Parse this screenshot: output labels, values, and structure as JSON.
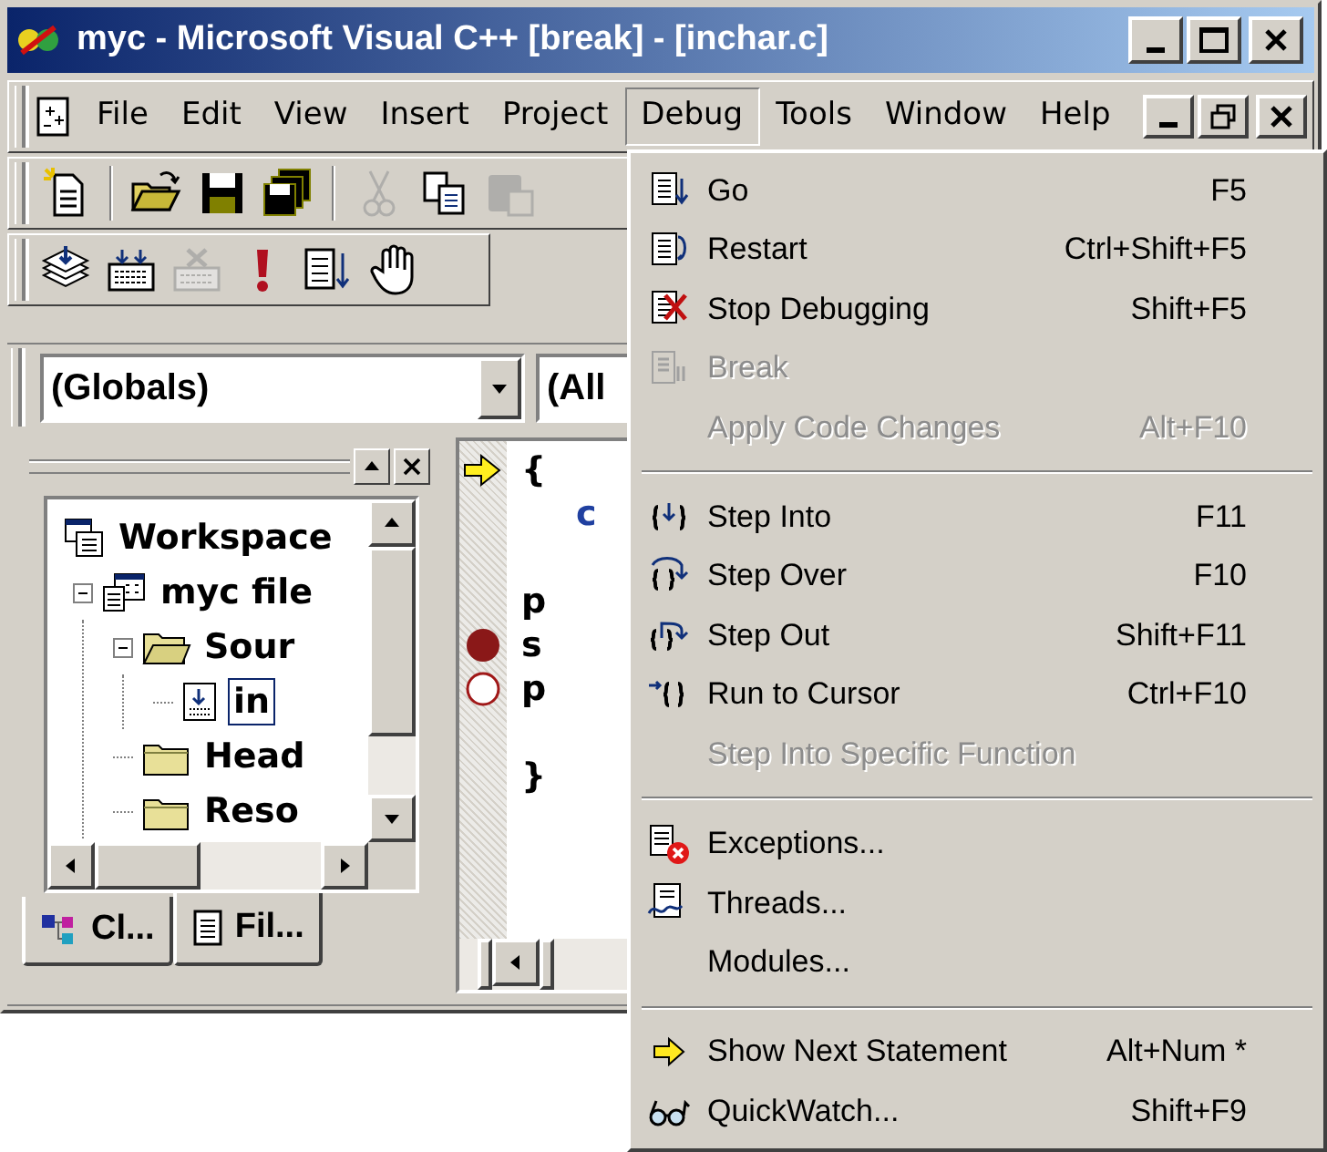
{
  "window": {
    "title": "myc - Microsoft Visual C++ [break] - [inchar.c]"
  },
  "menu_bar": [
    {
      "label": "File",
      "selected": false
    },
    {
      "label": "Edit",
      "selected": false
    },
    {
      "label": "View",
      "selected": false
    },
    {
      "label": "Insert",
      "selected": false
    },
    {
      "label": "Project",
      "selected": false
    },
    {
      "label": "Debug",
      "selected": true
    },
    {
      "label": "Tools",
      "selected": false
    },
    {
      "label": "Window",
      "selected": false
    },
    {
      "label": "Help",
      "selected": false
    }
  ],
  "toolbars": [
    [
      {
        "kind": "button",
        "disabled": false
      },
      {
        "kind": "separator"
      },
      {
        "kind": "button",
        "disabled": false
      },
      {
        "kind": "button",
        "disabled": false
      },
      {
        "kind": "button",
        "disabled": false
      },
      {
        "kind": "separator"
      },
      {
        "kind": "button",
        "disabled": true
      },
      {
        "kind": "button",
        "disabled": false
      },
      {
        "kind": "button",
        "disabled": true
      }
    ],
    [
      {
        "kind": "button",
        "disabled": false
      },
      {
        "kind": "button",
        "disabled": false
      },
      {
        "kind": "button",
        "disabled": true
      },
      {
        "kind": "button",
        "disabled": false
      },
      {
        "kind": "button",
        "disabled": false
      },
      {
        "kind": "button",
        "disabled": false
      }
    ]
  ],
  "combos": [
    {
      "value": "(Globals)"
    },
    {
      "value": "(All"
    }
  ],
  "workspace": {
    "tree": [
      {
        "label": "Workspace",
        "kind": "workspace",
        "selected": false,
        "children": [
          {
            "label": "myc file",
            "kind": "project",
            "selected": false,
            "expanded": true,
            "children": [
              {
                "label": "Sour",
                "kind": "folder",
                "selected": false,
                "expanded": true,
                "children": [
                  {
                    "label": "in",
                    "kind": "file",
                    "selected": true
                  }
                ]
              },
              {
                "label": "Head",
                "kind": "folder",
                "selected": false
              },
              {
                "label": "Reso",
                "kind": "folder",
                "selected": false
              }
            ]
          }
        ]
      }
    ],
    "tabs": [
      {
        "label": "Cl...",
        "selected": false
      },
      {
        "label": "Fil...",
        "selected": true
      }
    ]
  },
  "editor": {
    "lines": [
      {
        "kind": "code",
        "text": "{",
        "current": true,
        "breakpoint": false
      },
      {
        "kind": "keyword",
        "text": "c",
        "current": false,
        "breakpoint": false
      },
      {
        "kind": "blank",
        "current": false,
        "breakpoint": false
      },
      {
        "kind": "code",
        "text": "p",
        "current": false,
        "breakpoint": false
      },
      {
        "kind": "code",
        "text": "s",
        "current": false,
        "breakpoint": true,
        "enabled": true
      },
      {
        "kind": "code",
        "text": "p",
        "current": false,
        "breakpoint": true,
        "enabled": false
      },
      {
        "kind": "blank",
        "current": false,
        "breakpoint": false
      },
      {
        "kind": "code",
        "text": "}",
        "current": false,
        "breakpoint": false
      }
    ]
  },
  "debug_menu": [
    {
      "kind": "item",
      "label": "Go",
      "shortcut": "F5",
      "disabled": false
    },
    {
      "kind": "item",
      "label": "Restart",
      "shortcut": "Ctrl+Shift+F5",
      "disabled": false
    },
    {
      "kind": "item",
      "label": "Stop Debugging",
      "shortcut": "Shift+F5",
      "disabled": false
    },
    {
      "kind": "item",
      "label": "Break",
      "disabled": true
    },
    {
      "kind": "item",
      "label": "Apply Code Changes",
      "shortcut": "Alt+F10",
      "disabled": true
    },
    {
      "kind": "separator"
    },
    {
      "kind": "item",
      "label": "Step Into",
      "shortcut": "F11",
      "disabled": false
    },
    {
      "kind": "item",
      "label": "Step Over",
      "shortcut": "F10",
      "disabled": false
    },
    {
      "kind": "item",
      "label": "Step Out",
      "shortcut": "Shift+F11",
      "disabled": false
    },
    {
      "kind": "item",
      "label": "Run to Cursor",
      "shortcut": "Ctrl+F10",
      "disabled": false
    },
    {
      "kind": "item",
      "label": "Step Into Specific Function",
      "disabled": true
    },
    {
      "kind": "separator"
    },
    {
      "kind": "item",
      "label": "Exceptions...",
      "disabled": false
    },
    {
      "kind": "item",
      "label": "Threads...",
      "disabled": false
    },
    {
      "kind": "item",
      "label": "Modules...",
      "disabled": false
    },
    {
      "kind": "separator"
    },
    {
      "kind": "item",
      "label": "Show Next Statement",
      "shortcut": "Alt+Num *",
      "disabled": false
    },
    {
      "kind": "item",
      "label": "QuickWatch...",
      "shortcut": "Shift+F9",
      "disabled": false
    }
  ]
}
